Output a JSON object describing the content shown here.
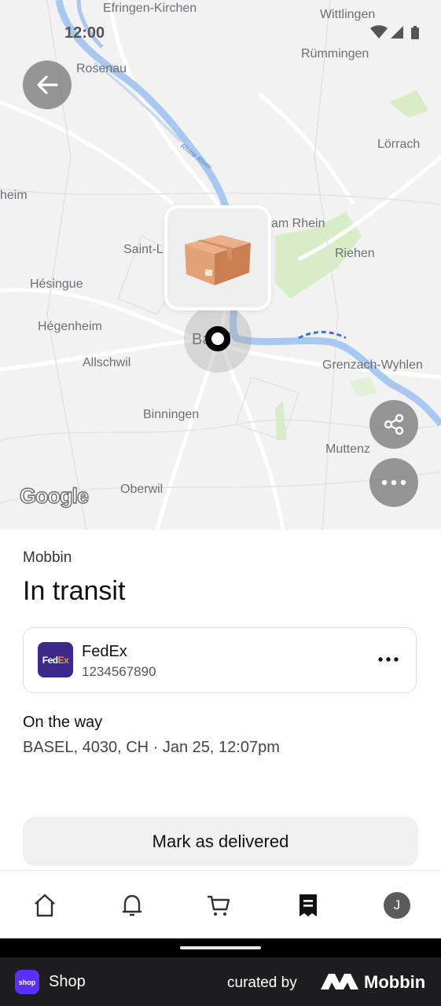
{
  "status_bar": {
    "time": "12:00"
  },
  "map": {
    "labels": {
      "efringen": "Efringen-Kirchen",
      "wittlingen": "Wittlingen",
      "ruemmingen": "Rümmingen",
      "rosenau": "Rosenau",
      "loerrach": "Lörrach",
      "heim": "heim",
      "am_rhein": "am Rhein",
      "saint_l": "Saint-L",
      "riehen": "Riehen",
      "hesingue": "Hésingue",
      "hegenheim": "Hégenheim",
      "basel": "Basel",
      "allschwil": "Allschwil",
      "grenzach": "Grenzach-Wyhlen",
      "binningen": "Binningen",
      "muttenz": "Muttenz",
      "oberwil": "Oberwil",
      "river": "Rhine River"
    },
    "google_logo": "Google"
  },
  "order": {
    "merchant": "Mobbin",
    "status": "In transit",
    "carrier": {
      "name": "FedEx",
      "logo_text_a": "Fed",
      "logo_text_b": "Ex",
      "tracking_number": "1234567890"
    },
    "latest_event": {
      "title": "On the way",
      "detail": "BASEL, 4030, CH · Jan 25, 12:07pm"
    },
    "primary_action": "Mark as delivered"
  },
  "nav": {
    "items": [
      "home-icon",
      "bell-icon",
      "cart-icon",
      "orders-icon",
      "avatar"
    ],
    "active": "orders-icon",
    "avatar_initial": "J"
  },
  "footer": {
    "app_icon_text": "shop",
    "app_name": "Shop",
    "curated_by": "curated by",
    "brand": "Mobbin"
  }
}
